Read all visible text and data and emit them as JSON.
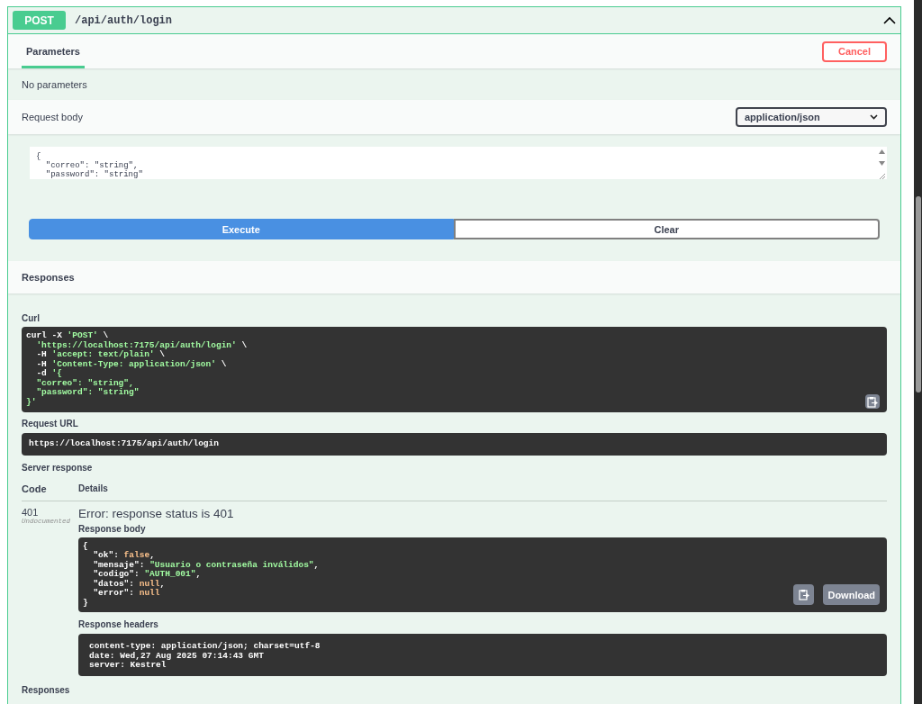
{
  "operation": {
    "method": "POST",
    "path": "/api/auth/login",
    "expanded": true
  },
  "parameters": {
    "tab": {
      "label": "Parameters",
      "selected": true
    },
    "cancel_button": "Cancel",
    "empty_text": "No parameters"
  },
  "request_body": {
    "label": "Request body",
    "content_type": "application/json",
    "example_lines": [
      "{",
      "  \"correo\": \"string\",",
      "  \"password\": \"string\""
    ]
  },
  "actions": [
    {
      "label": "Execute",
      "kind": "primary"
    },
    {
      "label": "Clear",
      "kind": "secondary"
    }
  ],
  "responses": {
    "title": "Responses",
    "curl": {
      "label": "Curl",
      "lines": [
        [
          {
            "text": "curl -X ",
            "kind": "plain"
          },
          {
            "text": "'POST'",
            "kind": "string"
          },
          {
            "text": " \\",
            "kind": "plain"
          }
        ],
        [
          {
            "text": "  'https://localhost:7175/api/auth/login'",
            "kind": "string"
          },
          {
            "text": " \\",
            "kind": "plain"
          }
        ],
        [
          {
            "text": "  -H ",
            "kind": "plain"
          },
          {
            "text": "'accept: text/plain'",
            "kind": "string"
          },
          {
            "text": " \\",
            "kind": "plain"
          }
        ],
        [
          {
            "text": "  -H ",
            "kind": "plain"
          },
          {
            "text": "'Content-Type: application/json'",
            "kind": "string"
          },
          {
            "text": " \\",
            "kind": "plain"
          }
        ],
        [
          {
            "text": "  -d ",
            "kind": "plain"
          },
          {
            "text": "'{",
            "kind": "string"
          }
        ],
        [
          {
            "text": "  \"correo\": \"string\",",
            "kind": "string"
          }
        ],
        [
          {
            "text": "  \"password\": \"string\"",
            "kind": "string"
          }
        ],
        [
          {
            "text": "}'",
            "kind": "string"
          }
        ]
      ]
    },
    "request_url": {
      "label": "Request URL",
      "value": "https://localhost:7175/api/auth/login"
    },
    "server_response": {
      "label": "Server response",
      "columns": [
        "Code",
        "Details"
      ],
      "code": "401",
      "code_note": "Undocumented",
      "error": "Error: response status is 401",
      "body": {
        "label": "Response body",
        "download_button": "Download",
        "lines": [
          [
            {
              "text": "{",
              "kind": "plain"
            }
          ],
          [
            {
              "text": "  \"ok\": ",
              "kind": "plain"
            },
            {
              "text": "false",
              "kind": "literal"
            },
            {
              "text": ",",
              "kind": "plain"
            }
          ],
          [
            {
              "text": "  \"mensaje\": ",
              "kind": "plain"
            },
            {
              "text": "\"Usuario o contraseña inválidos\"",
              "kind": "string"
            },
            {
              "text": ",",
              "kind": "plain"
            }
          ],
          [
            {
              "text": "  \"codigo\": ",
              "kind": "plain"
            },
            {
              "text": "\"AUTH_001\"",
              "kind": "string"
            },
            {
              "text": ",",
              "kind": "plain"
            }
          ],
          [
            {
              "text": "  \"datos\": ",
              "kind": "plain"
            },
            {
              "text": "null",
              "kind": "literal"
            },
            {
              "text": ",",
              "kind": "plain"
            }
          ],
          [
            {
              "text": "  \"error\": ",
              "kind": "plain"
            },
            {
              "text": "null",
              "kind": "literal"
            }
          ],
          [
            {
              "text": "}",
              "kind": "plain"
            }
          ]
        ]
      },
      "headers": {
        "label": "Response headers",
        "lines": [
          "content-type: application/json; charset=utf-8",
          "date: Wed,27 Aug 2025 07:14:43 GMT",
          "server: Kestrel"
        ]
      }
    },
    "footer_label": "Responses"
  }
}
